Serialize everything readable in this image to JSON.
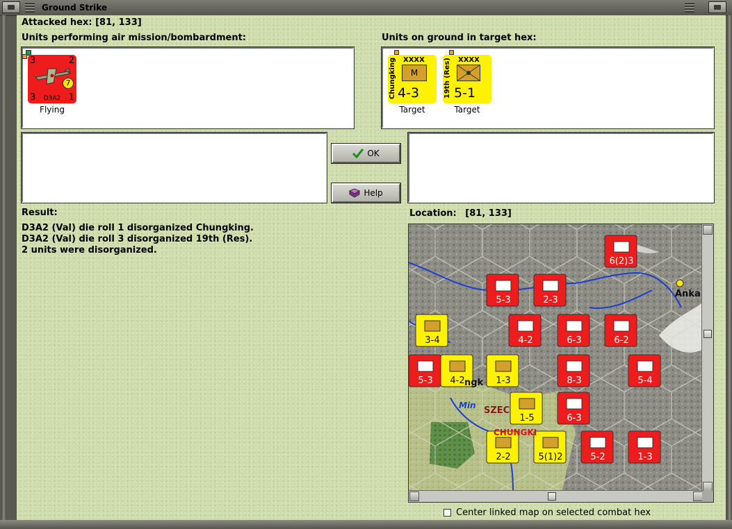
{
  "window": {
    "title": "Ground Strike"
  },
  "header": {
    "attacked_hex_label": "Attacked hex:",
    "attacked_hex_value": "[81, 133]"
  },
  "air_units": {
    "heading": "Units performing air mission/bombardment:",
    "units": [
      {
        "name": "D3A2",
        "status": "Flying",
        "top_left": "3",
        "top_right": "2",
        "bottom_left": "3",
        "bottom_right": "1",
        "badge": "7",
        "color": "#ee1c1c"
      }
    ]
  },
  "ground_units": {
    "heading": "Units on ground in target hex:",
    "units": [
      {
        "name": "Chungking",
        "size": "XXXX",
        "symbol": "M",
        "strength": "4-3",
        "status": "Target",
        "color": "#fff200"
      },
      {
        "name": "19th (Res)",
        "size": "XXXX",
        "symbol": "",
        "strength": "5-1",
        "status": "Target",
        "color": "#fff200"
      }
    ]
  },
  "buttons": {
    "ok": "OK",
    "help": "Help"
  },
  "result": {
    "heading": "Result:",
    "lines": [
      "D3A2 (Val) die roll 1 disorganized Chungking.",
      "D3A2 (Val) die roll 3 disorganized 19th (Res).",
      "2 units were disorganized."
    ]
  },
  "location": {
    "label": "Location:",
    "value": "[81, 133]"
  },
  "map": {
    "place_labels": [
      "Anka",
      "Min",
      "SZEC",
      "CHUNGKI",
      "ngk"
    ],
    "counters": [
      {
        "strength": "6(2)3",
        "color": "#ee1c1c"
      },
      {
        "strength": "5-3",
        "color": "#ee1c1c"
      },
      {
        "strength": "2-3",
        "color": "#ee1c1c"
      },
      {
        "strength": "3-4",
        "color": "#fff200"
      },
      {
        "strength": "4-2",
        "color": "#ee1c1c"
      },
      {
        "strength": "6-3",
        "color": "#ee1c1c"
      },
      {
        "strength": "6-2",
        "color": "#ee1c1c"
      },
      {
        "strength": "5-3",
        "color": "#ee1c1c"
      },
      {
        "strength": "4-2",
        "color": "#fff200"
      },
      {
        "strength": "1-3",
        "color": "#fff200"
      },
      {
        "strength": "8-3",
        "color": "#ee1c1c"
      },
      {
        "strength": "5-4",
        "color": "#ee1c1c"
      },
      {
        "strength": "1-5",
        "color": "#fff200"
      },
      {
        "strength": "6-3",
        "color": "#ee1c1c"
      },
      {
        "strength": "2-2",
        "color": "#fff200"
      },
      {
        "strength": "5(1)2",
        "color": "#fff200"
      },
      {
        "strength": "5-2",
        "color": "#ee1c1c"
      },
      {
        "strength": "1-3",
        "color": "#ee1c1c"
      }
    ]
  },
  "footer": {
    "checkbox_label": "Center linked map on selected combat hex",
    "checked": false
  },
  "colors": {
    "dialog_bg": "#cfdcab",
    "axis_red": "#ee1c1c",
    "china_yellow": "#fff200",
    "ok_check": "#1a8f1a"
  }
}
